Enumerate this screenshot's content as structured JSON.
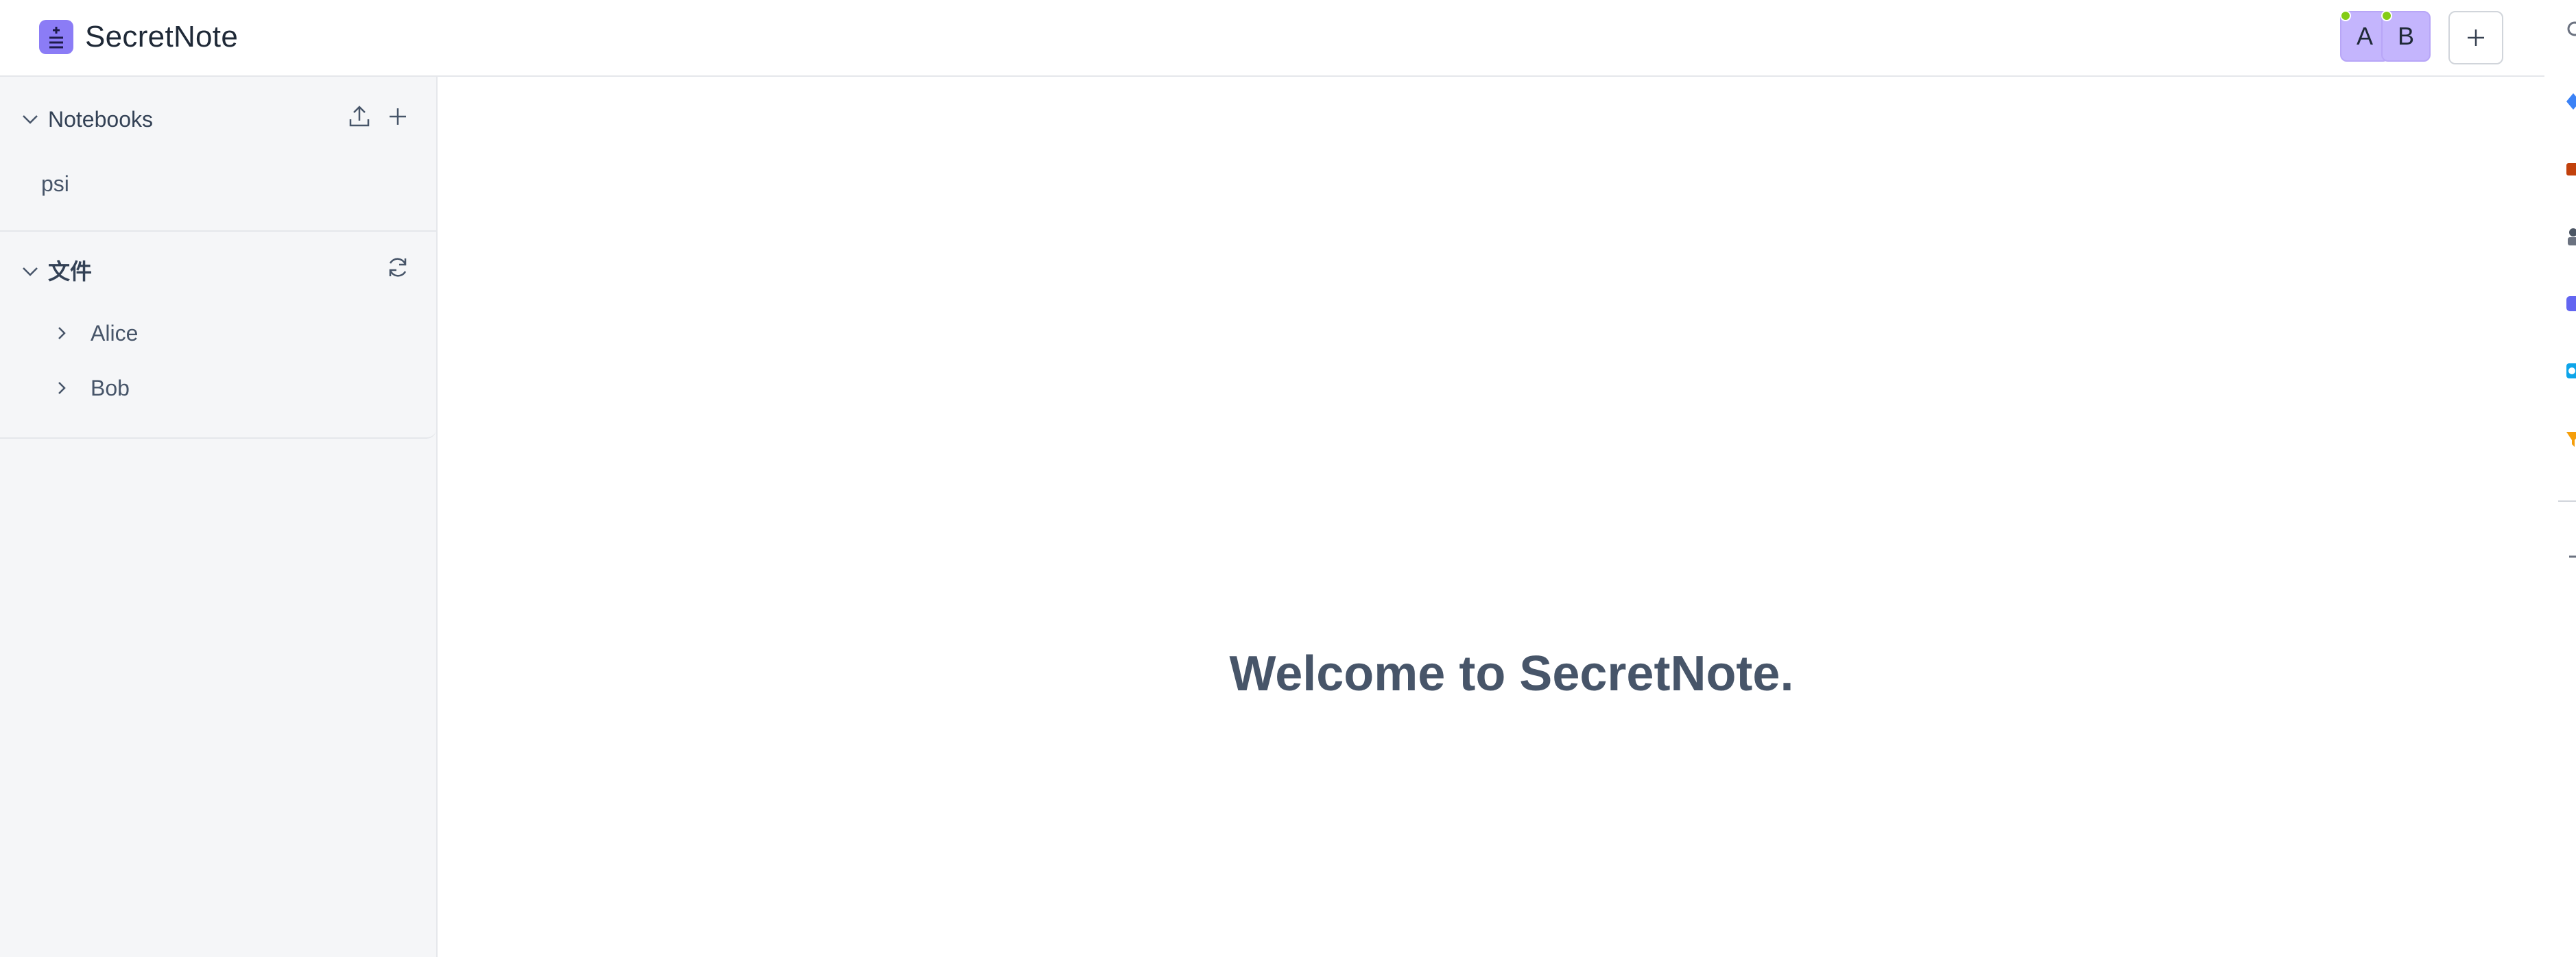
{
  "header": {
    "app_title": "SecretNote",
    "users": [
      {
        "initial": "A"
      },
      {
        "initial": "B"
      }
    ]
  },
  "sidebar": {
    "notebooks": {
      "title": "Notebooks",
      "items": [
        "psi"
      ]
    },
    "files": {
      "title": "文件",
      "folders": [
        "Alice",
        "Bob"
      ]
    }
  },
  "main": {
    "welcome_text": "Welcome to SecretNote."
  },
  "icons": {
    "logo": "note-logo-icon",
    "add_user": "plus-icon",
    "upload": "upload-icon",
    "add_notebook": "plus-icon",
    "refresh": "refresh-icon",
    "expand": "chevron-down-icon",
    "collapse": "chevron-right-icon"
  },
  "colors": {
    "accent": "#8b7cf6",
    "avatar_bg": "#c4b5fd",
    "presence": "#84cc16",
    "sidebar_bg": "#f5f6f8",
    "welcome_text": "#475569"
  }
}
